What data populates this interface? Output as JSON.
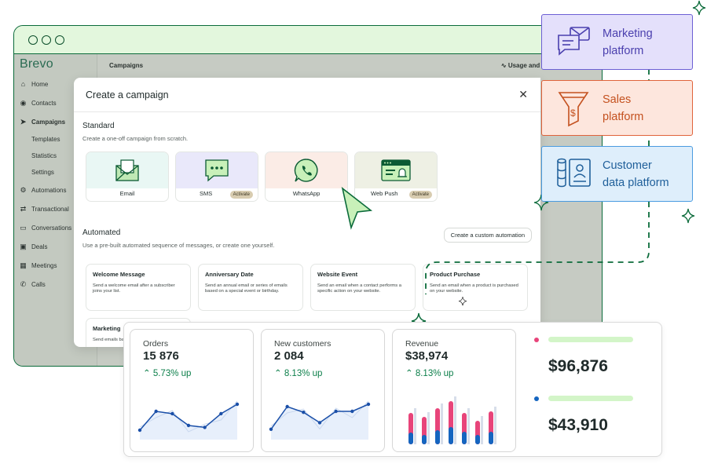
{
  "app": {
    "logo": "Brevo",
    "topbar": {
      "title": "Campaigns",
      "usage_label": "Usage and plan"
    }
  },
  "sidebar": {
    "items": [
      {
        "label": "Home",
        "icon": "home-icon"
      },
      {
        "label": "Contacts",
        "icon": "contacts-icon"
      },
      {
        "label": "Campaigns",
        "icon": "send-icon",
        "active": true
      },
      {
        "label": "Templates",
        "sub": true
      },
      {
        "label": "Statistics",
        "sub": true
      },
      {
        "label": "Settings",
        "sub": true
      },
      {
        "label": "Automations",
        "icon": "automation-icon"
      },
      {
        "label": "Transactional",
        "icon": "transactional-icon"
      },
      {
        "label": "Conversations",
        "icon": "chat-icon"
      },
      {
        "label": "Deals",
        "icon": "deals-icon"
      },
      {
        "label": "Meetings",
        "icon": "calendar-icon"
      },
      {
        "label": "Calls",
        "icon": "phone-icon"
      }
    ]
  },
  "modal": {
    "title": "Create a campaign",
    "standard_title": "Standard",
    "standard_sub": "Create a one-off campaign from scratch.",
    "channels": [
      {
        "label": "Email",
        "badge": ""
      },
      {
        "label": "SMS",
        "badge": "Activate"
      },
      {
        "label": "WhatsApp",
        "badge": ""
      },
      {
        "label": "Web Push",
        "badge": "Activate"
      }
    ],
    "automated_title": "Automated",
    "automated_sub": "Use a pre-built automated sequence of messages, or create one yourself.",
    "custom_button": "Create a custom automation",
    "automations": [
      {
        "title": "Welcome Message",
        "desc": "Send a welcome email after a subscriber joins your list."
      },
      {
        "title": "Anniversary Date",
        "desc": "Send an annual email or series of emails based on a special event or birthday."
      },
      {
        "title": "Website Event",
        "desc": "Send an email when a contact performs a specific action on your website."
      },
      {
        "title": "Product Purchase",
        "desc": "Send an email when a product is purchased on your website."
      }
    ],
    "more_title": "Marketing",
    "more_desc": "Send emails ba"
  },
  "platforms": [
    {
      "line1": "Marketing",
      "line2": "platform",
      "color": "#4a3fae",
      "bg": "#e4e0fb",
      "border": "#6c5fd4"
    },
    {
      "line1": "Sales",
      "line2": "platform",
      "color": "#c4511f",
      "bg": "#fde6dd",
      "border": "#e0633a"
    },
    {
      "line1": "Customer",
      "line2": "data platform",
      "color": "#1f5f9a",
      "bg": "#deeefb",
      "border": "#4a9be0"
    }
  ],
  "stats": [
    {
      "label": "Orders",
      "value": "15 876",
      "delta": "5.73% up"
    },
    {
      "label": "New customers",
      "value": "2 084",
      "delta": "8.13% up"
    },
    {
      "label": "Revenue",
      "value": "$38,974",
      "delta": "8.13% up"
    }
  ],
  "totals": [
    {
      "value": "$96,876",
      "dot_color": "#e8447a"
    },
    {
      "value": "$43,910",
      "dot_color": "#1565c0"
    }
  ],
  "charts": {
    "orders_line": [
      2,
      6,
      5.5,
      3,
      2.6,
      5.5,
      7.5
    ],
    "customers_line": [
      2.2,
      7,
      5.8,
      3.6,
      6,
      6,
      7.5
    ],
    "revenue_bars": [
      {
        "pink": 40,
        "blue": 15
      },
      {
        "pink": 35,
        "blue": 12
      },
      {
        "pink": 46,
        "blue": 18
      },
      {
        "pink": 55,
        "blue": 22
      },
      {
        "pink": 40,
        "blue": 16
      },
      {
        "pink": 30,
        "blue": 12
      },
      {
        "pink": 42,
        "blue": 16
      }
    ]
  }
}
